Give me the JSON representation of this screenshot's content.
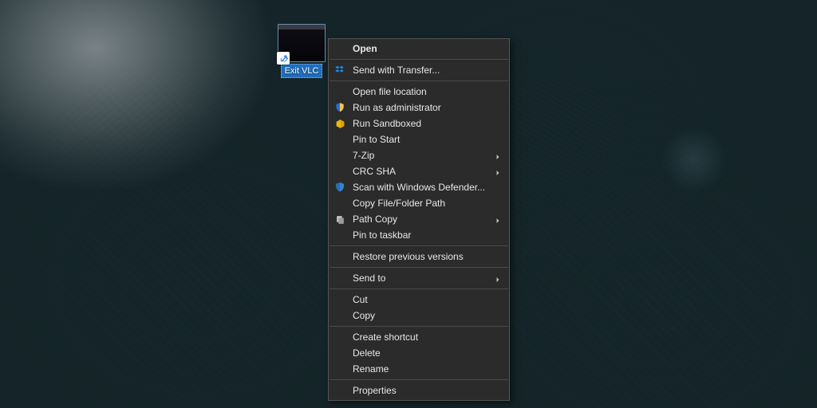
{
  "shortcut": {
    "label": "Exit VLC"
  },
  "context_menu": {
    "groups": [
      [
        {
          "label": "Open",
          "bold": true
        }
      ],
      [
        {
          "label": "Send with Transfer...",
          "icon": "dropbox"
        }
      ],
      [
        {
          "label": "Open file location"
        },
        {
          "label": "Run as administrator",
          "icon": "shield-uac"
        },
        {
          "label": "Run Sandboxed",
          "icon": "sandboxie"
        },
        {
          "label": "Pin to Start"
        },
        {
          "label": "7-Zip",
          "submenu": true
        },
        {
          "label": "CRC SHA",
          "submenu": true
        },
        {
          "label": "Scan with Windows Defender...",
          "icon": "defender"
        },
        {
          "label": "Copy File/Folder Path"
        },
        {
          "label": "Path Copy",
          "icon": "pathcopy",
          "submenu": true
        },
        {
          "label": "Pin to taskbar"
        }
      ],
      [
        {
          "label": "Restore previous versions"
        }
      ],
      [
        {
          "label": "Send to",
          "submenu": true
        }
      ],
      [
        {
          "label": "Cut"
        },
        {
          "label": "Copy"
        }
      ],
      [
        {
          "label": "Create shortcut"
        },
        {
          "label": "Delete"
        },
        {
          "label": "Rename"
        }
      ],
      [
        {
          "label": "Properties"
        }
      ]
    ]
  }
}
